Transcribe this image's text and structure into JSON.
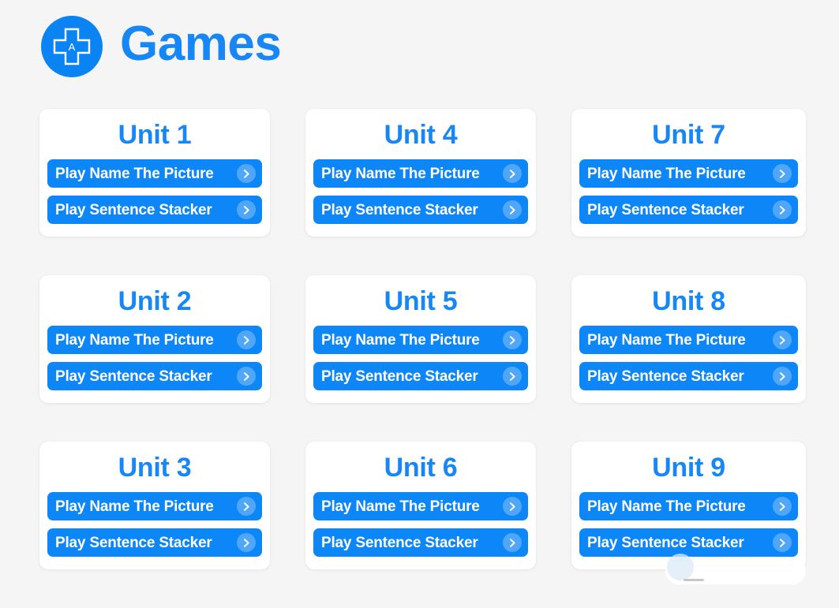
{
  "header": {
    "title": "Games",
    "logo_icon": "dpad-a-icon",
    "logo_letter": "A",
    "accent_color": "#1787f5",
    "logo_bg_color": "#0b84f3"
  },
  "theme": {
    "page_background": "#f5f5f5",
    "card_background": "#ffffff",
    "button_color": "#0d86f8",
    "button_text_color": "#ffffff",
    "title_color": "#1787f5"
  },
  "units": [
    {
      "title": "Unit 1",
      "buttons": [
        {
          "label": "Play Name The Picture",
          "icon": "chevron-right-icon"
        },
        {
          "label": "Play Sentence Stacker",
          "icon": "chevron-right-icon"
        }
      ]
    },
    {
      "title": "Unit 4",
      "buttons": [
        {
          "label": "Play Name The Picture",
          "icon": "chevron-right-icon"
        },
        {
          "label": "Play Sentence Stacker",
          "icon": "chevron-right-icon"
        }
      ]
    },
    {
      "title": "Unit 7",
      "buttons": [
        {
          "label": "Play Name The Picture",
          "icon": "chevron-right-icon"
        },
        {
          "label": "Play Sentence Stacker",
          "icon": "chevron-right-icon"
        }
      ]
    },
    {
      "title": "Unit 2",
      "buttons": [
        {
          "label": "Play Name The Picture",
          "icon": "chevron-right-icon"
        },
        {
          "label": "Play Sentence Stacker",
          "icon": "chevron-right-icon"
        }
      ]
    },
    {
      "title": "Unit 5",
      "buttons": [
        {
          "label": "Play Name The Picture",
          "icon": "chevron-right-icon"
        },
        {
          "label": "Play Sentence Stacker",
          "icon": "chevron-right-icon"
        }
      ]
    },
    {
      "title": "Unit 8",
      "buttons": [
        {
          "label": "Play Name The Picture",
          "icon": "chevron-right-icon"
        },
        {
          "label": "Play Sentence Stacker",
          "icon": "chevron-right-icon"
        }
      ]
    },
    {
      "title": "Unit 3",
      "buttons": [
        {
          "label": "Play Name The Picture",
          "icon": "chevron-right-icon"
        },
        {
          "label": "Play Sentence Stacker",
          "icon": "chevron-right-icon"
        }
      ]
    },
    {
      "title": "Unit 6",
      "buttons": [
        {
          "label": "Play Name The Picture",
          "icon": "chevron-right-icon"
        },
        {
          "label": "Play Sentence Stacker",
          "icon": "chevron-right-icon"
        }
      ]
    },
    {
      "title": "Unit 9",
      "buttons": [
        {
          "label": "Play Name The Picture",
          "icon": "chevron-right-icon"
        },
        {
          "label": "Play Sentence Stacker",
          "icon": "chevron-right-icon"
        }
      ]
    }
  ],
  "chat_widget": {
    "visible": true,
    "avatar_icon": "avatar-icon"
  }
}
